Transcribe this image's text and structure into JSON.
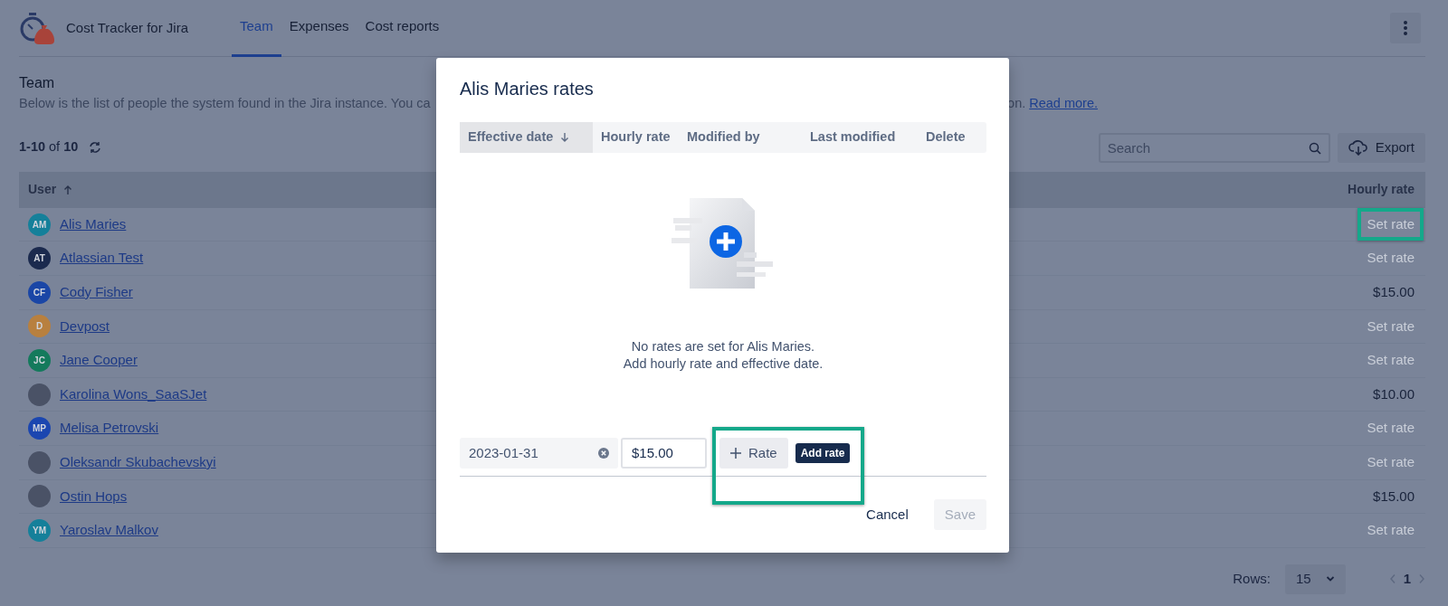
{
  "app": {
    "name": "Cost Tracker for Jira"
  },
  "nav_tabs": [
    {
      "label": "Team",
      "selected": true
    },
    {
      "label": "Expenses",
      "selected": false
    },
    {
      "label": "Cost reports",
      "selected": false
    }
  ],
  "page": {
    "title": "Team",
    "description_start": "Below is the list of people the system found in the Jira instance. You ca",
    "description_end": "on.",
    "read_more_link": "Read more."
  },
  "count": "**1-10** of **10**",
  "search": {
    "placeholder": "Search"
  },
  "export_button": "Export",
  "table": {
    "columns": [
      {
        "label": "User",
        "sorted": true,
        "descending": false
      },
      {
        "label": "Hourly rate",
        "sorted": false
      }
    ],
    "rows": [
      {
        "kind": "initials",
        "initials": "AM",
        "color": "#15809a",
        "name": "Alis Maries",
        "rate": "Set rate",
        "rate_set": false,
        "highlighted": true
      },
      {
        "kind": "initials",
        "initials": "AT",
        "color": "#1b2a4e",
        "name": "Atlassian Test",
        "rate": "Set rate",
        "rate_set": false,
        "highlighted": false
      },
      {
        "kind": "initials",
        "initials": "CF",
        "color": "#1a46a6",
        "name": "Cody Fisher",
        "rate": "$15.00",
        "rate_set": true,
        "highlighted": false
      },
      {
        "kind": "initials",
        "initials": "D",
        "color": "#b8803f",
        "name": "Devpost",
        "rate": "Set rate",
        "rate_set": false,
        "highlighted": false
      },
      {
        "kind": "initials",
        "initials": "JC",
        "color": "#147a5c",
        "name": "Jane Cooper",
        "rate": "Set rate",
        "rate_set": false,
        "highlighted": false
      },
      {
        "kind": "photo",
        "name": "Karolina Wons_SaaSJet",
        "rate": "$10.00",
        "rate_set": true,
        "highlighted": false
      },
      {
        "kind": "initials",
        "initials": "MP",
        "color": "#1b46b0",
        "name": "Melisa Petrovski",
        "rate": "Set rate",
        "rate_set": false,
        "highlighted": false
      },
      {
        "kind": "photo",
        "name": "Oleksandr Skubachevskyi",
        "rate": "Set rate",
        "rate_set": false,
        "highlighted": false
      },
      {
        "kind": "photo",
        "name": "Ostin Hops",
        "rate": "$15.00",
        "rate_set": true,
        "highlighted": false
      },
      {
        "kind": "initials",
        "initials": "YM",
        "color": "#15809a",
        "name": "Yaroslav Malkov",
        "rate": "Set rate",
        "rate_set": false,
        "highlighted": false
      }
    ]
  },
  "pagination": {
    "rows_label": "Rows:",
    "rows_value": "15",
    "page": "1"
  },
  "modal": {
    "title": "Alis Maries rates",
    "columns": [
      {
        "label": "Effective date",
        "sorted": true,
        "descending": true
      },
      {
        "label": "Hourly rate",
        "sorted": false
      },
      {
        "label": "Modified by",
        "sorted": false
      },
      {
        "label": "Last modified",
        "sorted": false
      },
      {
        "label": "Delete",
        "sorted": false
      }
    ],
    "empty_message": [
      "No rates are set for Alis Maries.",
      "Add hourly rate and effective date."
    ],
    "form": {
      "date_value": "2023-01-31",
      "rate_value": "$15.00",
      "add_button": "Rate",
      "tooltip": "Add rate",
      "highlighted": true
    },
    "buttons": [
      {
        "kind": "subtle",
        "label": "Cancel",
        "disabled": false
      },
      {
        "kind": "primary",
        "label": "Save",
        "disabled": true
      }
    ]
  }
}
